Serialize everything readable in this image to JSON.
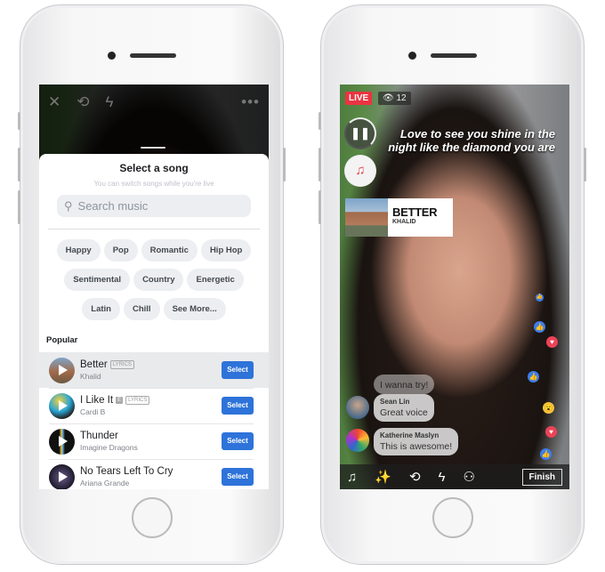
{
  "left": {
    "top_icons": [
      "close-icon",
      "camera-flip-icon",
      "flash-off-icon",
      "more-icon"
    ],
    "sheet": {
      "title": "Select a song",
      "subtitle": "You can switch songs while you're live",
      "search_placeholder": "Search music",
      "chips": [
        [
          "Happy",
          "Pop",
          "Romantic",
          "Hip Hop"
        ],
        [
          "Sentimental",
          "Country",
          "Energetic"
        ],
        [
          "Latin",
          "Chill",
          "See More..."
        ]
      ],
      "section": "Popular",
      "songs": [
        {
          "title": "Better",
          "artist": "Khalid",
          "explicit": false,
          "lyrics": "LYRICS",
          "select": "Select",
          "selected": true
        },
        {
          "title": "I Like It",
          "artist": "Cardi B",
          "explicit": "E",
          "lyrics": "LYRICS",
          "select": "Select"
        },
        {
          "title": "Thunder",
          "artist": "Imagine Dragons",
          "select": "Select"
        },
        {
          "title": "No Tears Left To Cry",
          "artist": "Ariana Grande",
          "select": "Select"
        }
      ]
    }
  },
  "right": {
    "live": "LIVE",
    "viewers": "12",
    "lyrics": "Love to see you shine in the night like the diamond you are",
    "now_playing": {
      "title": "BETTER",
      "artist": "KHALID"
    },
    "comments": [
      {
        "message": "I wanna try!"
      },
      {
        "user": "Sean Lin",
        "message": "Great voice"
      },
      {
        "user": "Katherine Maslyn",
        "message": "This is awesome!"
      }
    ],
    "finish": "Finish",
    "colors": {
      "live": "#eb3341",
      "accent": "#2d73d9"
    }
  }
}
